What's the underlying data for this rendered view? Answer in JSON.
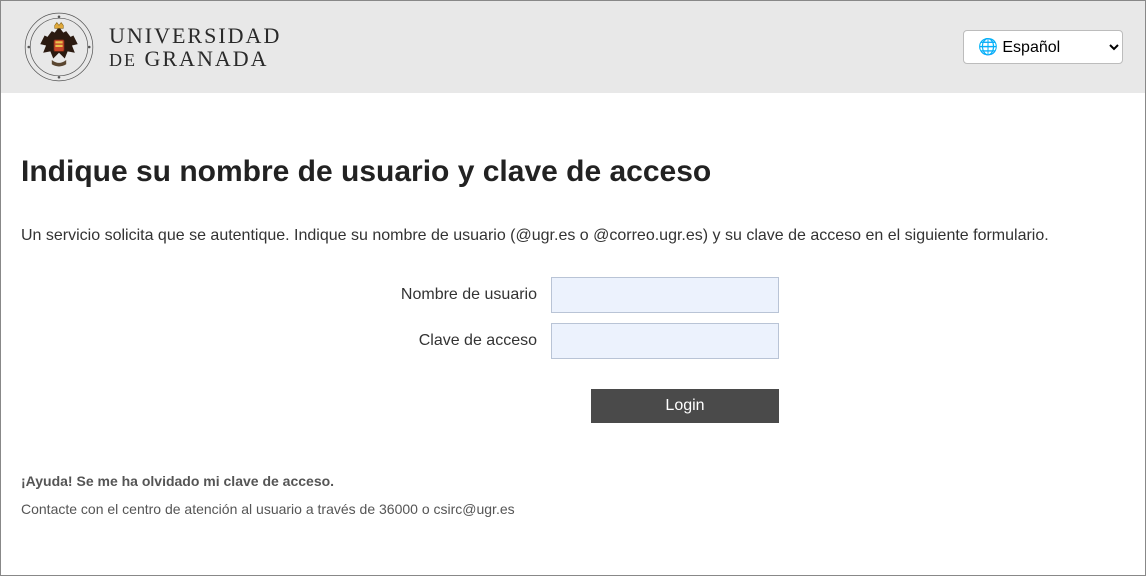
{
  "header": {
    "university_line1": "UNIVERSIDAD",
    "university_line2_prefix": "DE",
    "university_line2_name": "GRANADA",
    "language_selected": "🌐 Español"
  },
  "main": {
    "title": "Indique su nombre de usuario y clave de acceso",
    "description": "Un servicio solicita que se autentique. Indique su nombre de usuario (@ugr.es o @correo.ugr.es) y su clave de acceso en el siguiente formulario.",
    "form": {
      "username_label": "Nombre de usuario",
      "username_value": "",
      "password_label": "Clave de acceso",
      "password_value": "",
      "submit_label": "Login"
    },
    "help": {
      "forgot_text": "¡Ayuda! Se me ha olvidado mi clave de acceso.",
      "contact_text": "Contacte con el centro de atención al usuario a través de 36000 o csirc@ugr.es"
    }
  }
}
